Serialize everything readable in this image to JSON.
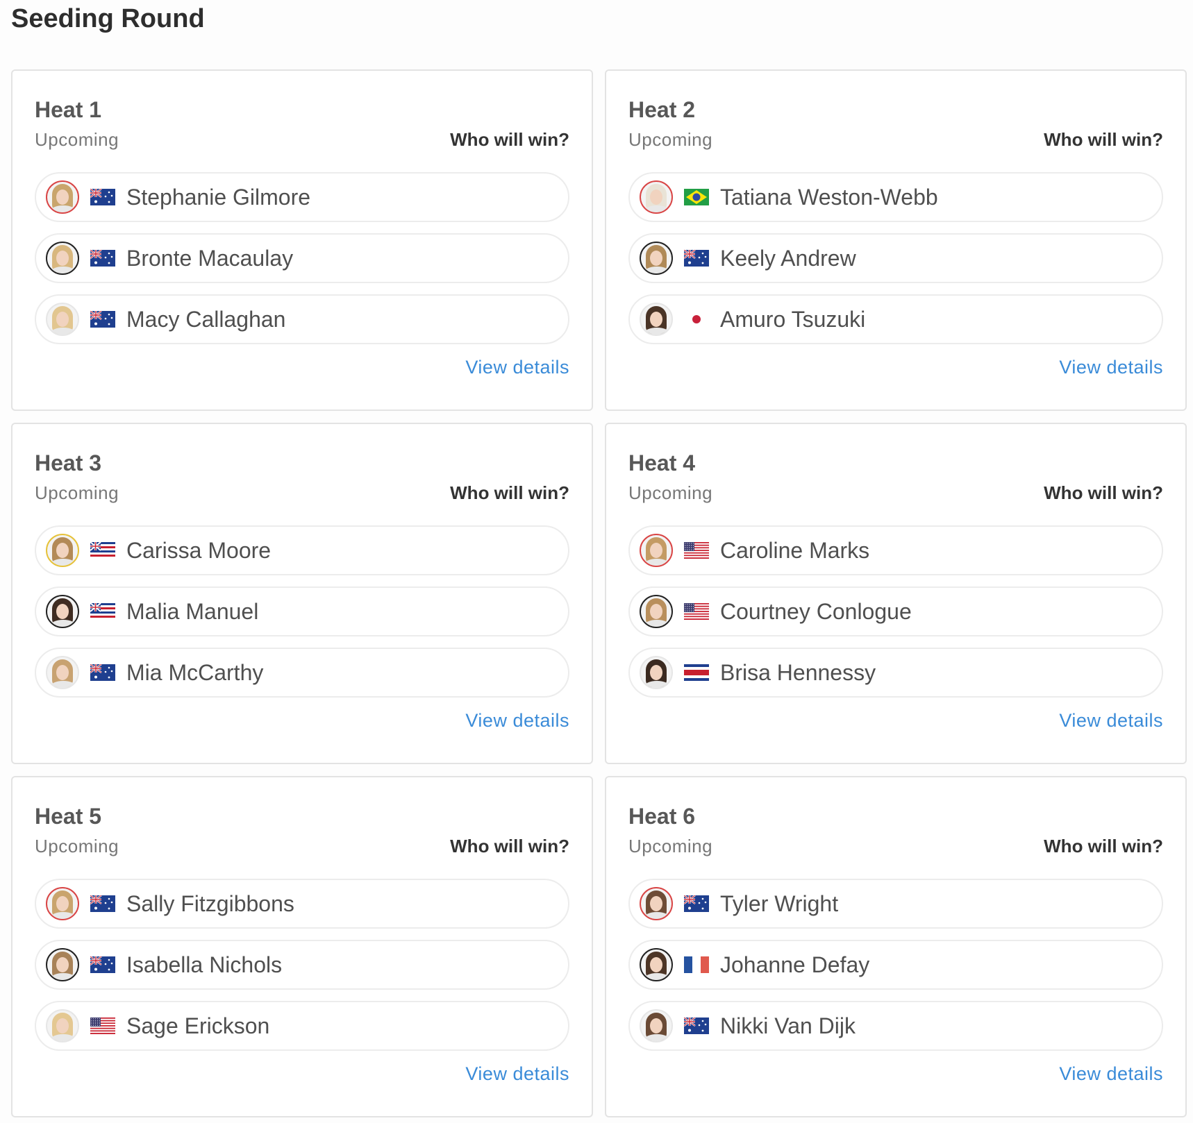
{
  "round": {
    "title": "Seeding Round"
  },
  "heats": [
    {
      "title": "Heat 1",
      "status": "Upcoming",
      "prompt": "Who will win?",
      "link": "View details",
      "surfers": [
        {
          "name": "Stephanie Gilmore",
          "flag": "australia",
          "ring": "#d94545",
          "hair": "#c9a56c"
        },
        {
          "name": "Bronte Macaulay",
          "flag": "australia",
          "ring": "#222222",
          "hair": "#d8b77e"
        },
        {
          "name": "Macy Callaghan",
          "flag": "australia",
          "ring": "#ffffff",
          "hair": "#e2c690"
        }
      ]
    },
    {
      "title": "Heat 2",
      "status": "Upcoming",
      "prompt": "Who will win?",
      "link": "View details",
      "surfers": [
        {
          "name": "Tatiana Weston-Webb",
          "flag": "brazil",
          "ring": "#d94545",
          "hair": "#e9e3d6"
        },
        {
          "name": "Keely Andrew",
          "flag": "australia",
          "ring": "#222222",
          "hair": "#b08a58"
        },
        {
          "name": "Amuro Tsuzuki",
          "flag": "japan",
          "ring": "#ffffff",
          "hair": "#4a3426"
        }
      ]
    },
    {
      "title": "Heat 3",
      "status": "Upcoming",
      "prompt": "Who will win?",
      "link": "View details",
      "surfers": [
        {
          "name": "Carissa Moore",
          "flag": "hawaii",
          "ring": "#e6c23a",
          "hair": "#b38a57"
        },
        {
          "name": "Malia Manuel",
          "flag": "hawaii",
          "ring": "#222222",
          "hair": "#3f2c21"
        },
        {
          "name": "Mia McCarthy",
          "flag": "australia",
          "ring": "#ffffff",
          "hair": "#c8a271"
        }
      ]
    },
    {
      "title": "Heat 4",
      "status": "Upcoming",
      "prompt": "Who will win?",
      "link": "View details",
      "surfers": [
        {
          "name": "Caroline Marks",
          "flag": "usa",
          "ring": "#d94545",
          "hair": "#c49b64"
        },
        {
          "name": "Courtney Conlogue",
          "flag": "usa",
          "ring": "#222222",
          "hair": "#b98f5c"
        },
        {
          "name": "Brisa Hennessy",
          "flag": "costa-rica",
          "ring": "#ffffff",
          "hair": "#3b2a20"
        }
      ]
    },
    {
      "title": "Heat 5",
      "status": "Upcoming",
      "prompt": "Who will win?",
      "link": "View details",
      "surfers": [
        {
          "name": "Sally Fitzgibbons",
          "flag": "australia",
          "ring": "#d94545",
          "hair": "#c9a46d"
        },
        {
          "name": "Isabella Nichols",
          "flag": "australia",
          "ring": "#222222",
          "hair": "#a88258"
        },
        {
          "name": "Sage Erickson",
          "flag": "usa",
          "ring": "#ffffff",
          "hair": "#e4c892"
        }
      ]
    },
    {
      "title": "Heat 6",
      "status": "Upcoming",
      "prompt": "Who will win?",
      "link": "View details",
      "surfers": [
        {
          "name": "Tyler Wright",
          "flag": "australia",
          "ring": "#d94545",
          "hair": "#6e4c36"
        },
        {
          "name": "Johanne Defay",
          "flag": "france",
          "ring": "#222222",
          "hair": "#4d3526"
        },
        {
          "name": "Nikki Van Dijk",
          "flag": "australia",
          "ring": "#ffffff",
          "hair": "#6a4a35"
        }
      ]
    }
  ],
  "colors": {
    "link": "#3a8bd8",
    "card_border": "#e3e3e3",
    "pill_border": "#ececec"
  }
}
